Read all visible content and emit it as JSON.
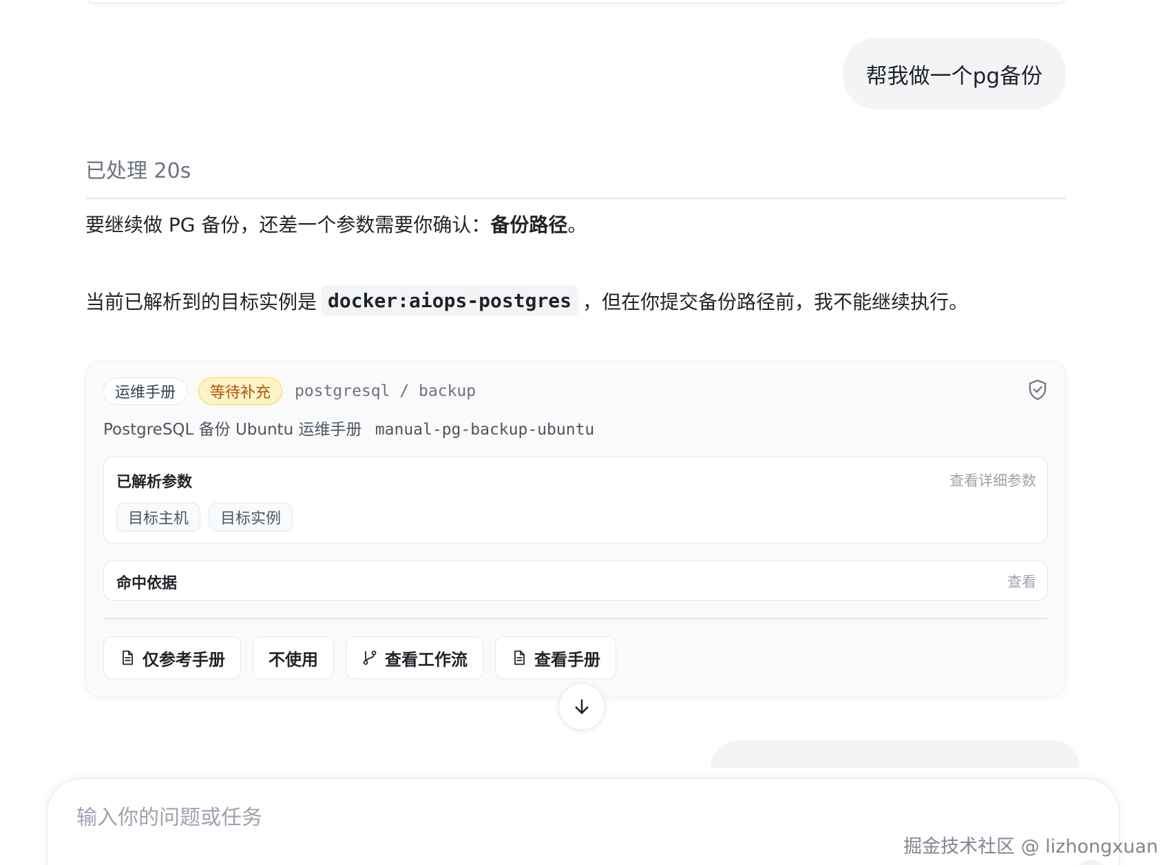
{
  "chat": {
    "user_message": "帮我做一个pg备份",
    "processed_label": "已处理 20s",
    "para1_prefix": "要继续做 PG 备份，还差一个参数需要你确认：",
    "para1_bold": "备份路径",
    "para1_suffix": "。",
    "para2_prefix": "当前已解析到的目标实例是",
    "para2_code": "docker:aiops-postgres",
    "para2_suffix": "，但在你提交备份路径前，我不能继续执行。"
  },
  "runbook_card": {
    "tag_runbook": "运维手册",
    "tag_status": "等待补充",
    "path": "postgresql / backup",
    "title": "PostgreSQL 备份 Ubuntu 运维手册",
    "id": "manual-pg-backup-ubuntu",
    "shield_icon": "shield-check-icon",
    "parsed_params": {
      "title": "已解析参数",
      "link": "查看详细参数",
      "chips": [
        "目标主机",
        "目标实例"
      ]
    },
    "match_basis": {
      "title": "命中依据",
      "link": "查看"
    },
    "actions": [
      {
        "label": "仅参考手册",
        "icon": "document-icon"
      },
      {
        "label": "不使用",
        "icon": ""
      },
      {
        "label": "查看工作流",
        "icon": "git-branch-icon"
      },
      {
        "label": "查看手册",
        "icon": "document-icon"
      }
    ]
  },
  "composer": {
    "placeholder": "输入你的问题或任务"
  },
  "watermark": "掘金技术社区 @ lizhongxuan",
  "colors": {
    "status_bg": "#fef3c7",
    "status_text": "#b45309",
    "muted_text": "#9ca3af",
    "bubble_bg": "#f3f4f6"
  }
}
